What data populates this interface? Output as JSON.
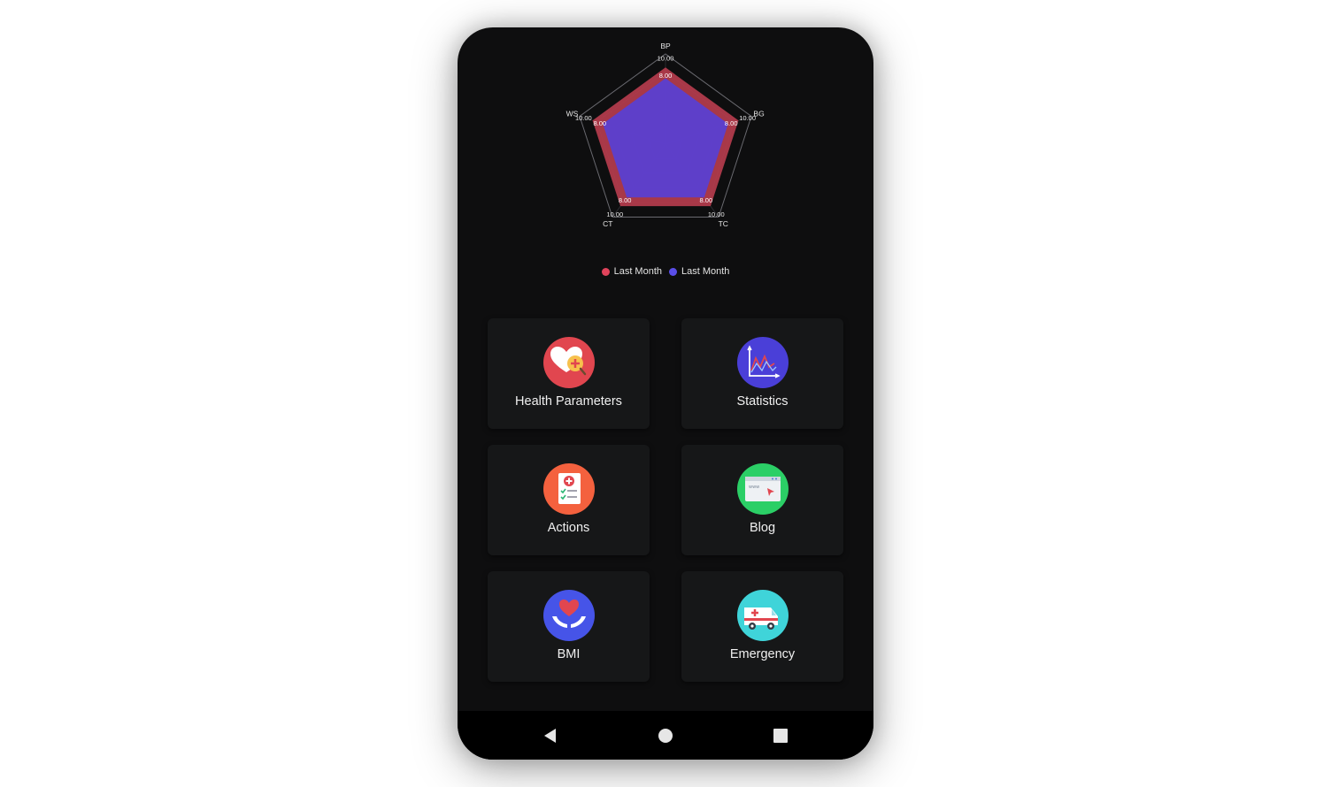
{
  "colors": {
    "background": "#0e0e0f",
    "card": "#161718",
    "last_month_red": "#b13b4c",
    "last_month_blue": "#5a3fd1"
  },
  "radar": {
    "axes": [
      "BP",
      "BG",
      "TC",
      "CT",
      "WS"
    ],
    "ticks": {
      "outer": "10.00",
      "inner": "8.00"
    }
  },
  "chart_data": {
    "type": "radar",
    "categories": [
      "BP",
      "BG",
      "TC",
      "CT",
      "WS"
    ],
    "series": [
      {
        "name": "Last Month",
        "color": "#b13b4c",
        "values": [
          8.5,
          8.5,
          8.5,
          8.5,
          8.5
        ]
      },
      {
        "name": "Last Month",
        "color": "#5a3fd1",
        "values": [
          7.3,
          7.3,
          7.3,
          7.3,
          7.3
        ]
      }
    ],
    "range": [
      0,
      10
    ],
    "legend": "bottom"
  },
  "legend": {
    "items": [
      {
        "label": "Last Month",
        "color": "#e0435b"
      },
      {
        "label": "Last Month",
        "color": "#5a4ee8"
      }
    ]
  },
  "menu": [
    {
      "label": "Health Parameters",
      "icon": "heart-search-icon",
      "color": "#e1464f"
    },
    {
      "label": "Statistics",
      "icon": "line-chart-icon",
      "color": "#4a3fd8"
    },
    {
      "label": "Actions",
      "icon": "medical-checklist-icon",
      "color": "#f4613e"
    },
    {
      "label": "Blog",
      "icon": "web-browser-icon",
      "color": "#2bcf66"
    },
    {
      "label": "BMI",
      "icon": "heart-hands-icon",
      "color": "#4654e8"
    },
    {
      "label": "Emergency",
      "icon": "ambulance-icon",
      "color": "#3fd4d9"
    }
  ],
  "nav": {
    "buttons": [
      "back-icon",
      "home-icon",
      "recents-icon"
    ]
  }
}
